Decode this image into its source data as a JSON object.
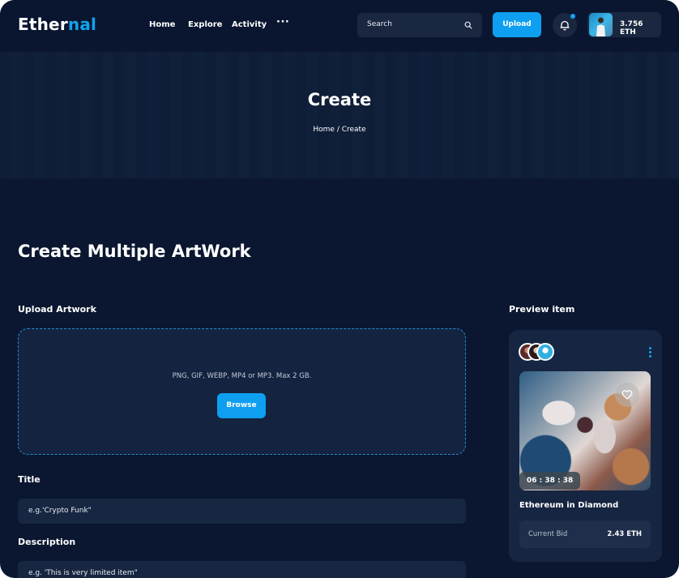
{
  "brand": {
    "logo_part1": "Ether",
    "logo_part2": "nal",
    "accent": "#0f9ff0"
  },
  "nav": {
    "home": "Home",
    "explore": "Explore",
    "activity": "Activity",
    "more": "···"
  },
  "search": {
    "placeholder": "Search",
    "icon": "search-icon"
  },
  "header": {
    "upload_label": "Upload",
    "notification_icon": "bell-icon",
    "wallet_balance": "3.756 ETH"
  },
  "hero": {
    "title": "Create",
    "breadcrumb": "Home / Create"
  },
  "page": {
    "section_title": "Create Multiple ArtWork"
  },
  "upload": {
    "label": "Upload Artwork",
    "hint": "PNG, GIF, WEBP, MP4 or MP3. Max 2 GB.",
    "browse_label": "Browse"
  },
  "form": {
    "title_label": "Title",
    "title_placeholder": "e.g.'Crypto Funk\"",
    "description_label": "Description",
    "description_placeholder": "e.g. 'This is very limited item\""
  },
  "preview": {
    "label": "Preview item",
    "timer": "06 : 38 : 38",
    "item_name": "Ethereum in Diamond",
    "bid_label": "Current Bid",
    "bid_value": "2.43 ETH",
    "like_icon": "heart-icon",
    "menu_icon": "kebab-menu-icon"
  }
}
